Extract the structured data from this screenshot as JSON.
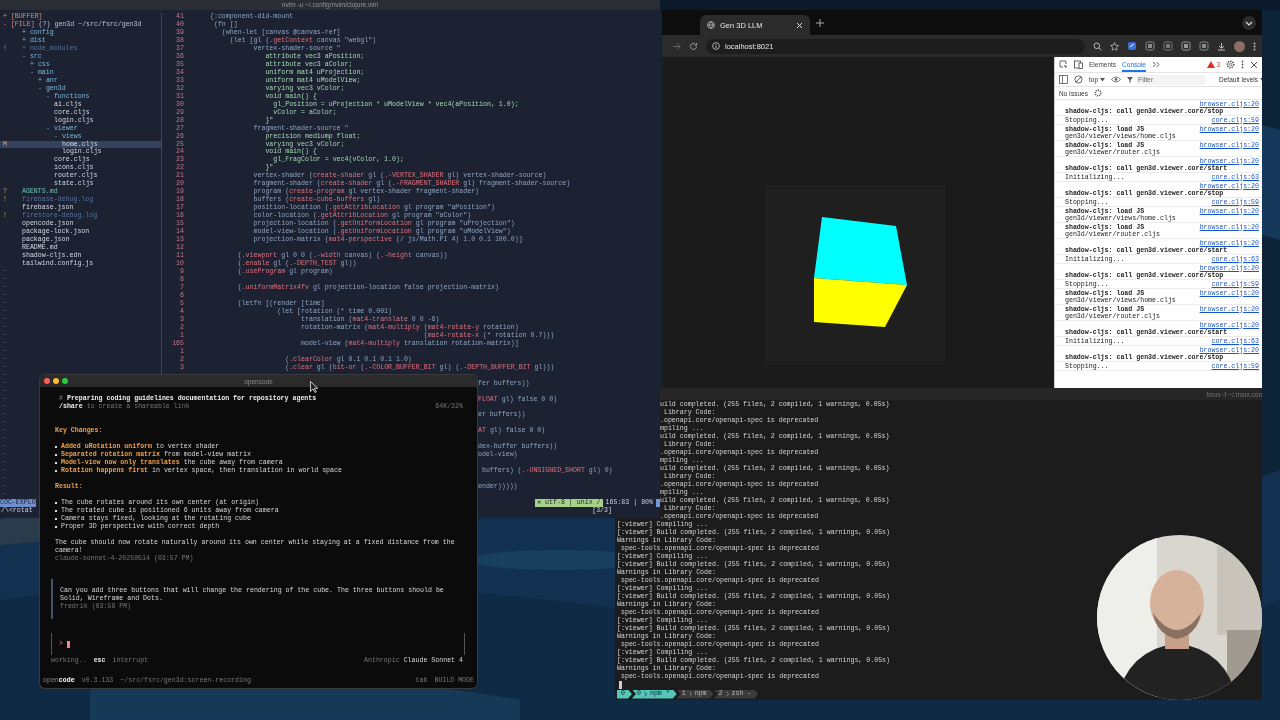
{
  "editor": {
    "title": "nvim -u ~/.config/nvim/clojure.vim",
    "tree": [
      {
        "sign": "+",
        "label": "[BUFFER]",
        "kind": "root",
        "selected": false
      },
      {
        "sign": "-",
        "label": "[FILE]",
        "path": "(?) gen3d ~/src/fsrc/gen3d",
        "kind": "root",
        "selected": false,
        "children": [
          {
            "sign": "+",
            "label": "config",
            "kind": "dir",
            "selected": false
          },
          {
            "sign": "+",
            "label": "dist",
            "kind": "dir",
            "selected": false
          },
          {
            "sign": "+",
            "label": "node_modules",
            "kind": "ignored",
            "mark": "!",
            "selected": false
          },
          {
            "sign": "-",
            "label": "src",
            "kind": "dir",
            "selected": false,
            "children": [
              {
                "sign": "+",
                "label": "css",
                "kind": "dir",
                "selected": false
              },
              {
                "sign": "-",
                "label": "main",
                "kind": "dir",
                "selected": false,
                "children": [
                  {
                    "sign": "+",
                    "label": "anr",
                    "kind": "dir",
                    "selected": false
                  },
                  {
                    "sign": "-",
                    "label": "gen3d",
                    "kind": "dir",
                    "selected": false,
                    "children": [
                      {
                        "sign": "-",
                        "label": "functions",
                        "kind": "dir",
                        "selected": false,
                        "children": [
                          {
                            "label": "ai.cljs",
                            "kind": "file",
                            "selected": false
                          },
                          {
                            "label": "core.cljs",
                            "kind": "file",
                            "selected": false
                          },
                          {
                            "label": "login.cljs",
                            "kind": "file",
                            "selected": false
                          }
                        ]
                      },
                      {
                        "sign": "-",
                        "label": "viewer",
                        "kind": "dir",
                        "selected": false,
                        "children": [
                          {
                            "sign": "-",
                            "label": "views",
                            "kind": "dir",
                            "selected": false,
                            "children": [
                              {
                                "label": "home.cljs",
                                "kind": "file",
                                "mark": "M",
                                "selected": true
                              },
                              {
                                "label": "login.cljs",
                                "kind": "file",
                                "selected": false
                              }
                            ]
                          },
                          {
                            "label": "core.cljs",
                            "kind": "file",
                            "selected": false
                          },
                          {
                            "label": "icons.cljs",
                            "kind": "file",
                            "selected": false
                          },
                          {
                            "label": "router.cljs",
                            "kind": "file",
                            "selected": false
                          },
                          {
                            "label": "state.cljs",
                            "kind": "file",
                            "selected": false
                          }
                        ]
                      }
                    ]
                  }
                ]
              }
            ]
          },
          {
            "label": "AGENTS.md",
            "kind": "untracked",
            "mark": "?",
            "selected": false
          },
          {
            "label": "firebase-debug.log",
            "kind": "ignored",
            "mark": "!",
            "selected": false
          },
          {
            "label": "firebase.json",
            "kind": "file",
            "selected": false
          },
          {
            "label": "firestore-debug.log",
            "kind": "ignored",
            "mark": "!",
            "selected": false
          },
          {
            "label": "opencode.json",
            "kind": "file",
            "selected": false
          },
          {
            "label": "package-lock.json",
            "kind": "file",
            "selected": false
          },
          {
            "label": "package.json",
            "kind": "file",
            "selected": false
          },
          {
            "label": "README.md",
            "kind": "file",
            "selected": false
          },
          {
            "label": "shadow-cljs.edn",
            "kind": "file",
            "selected": false
          },
          {
            "label": "tailwind.config.js",
            "kind": "file",
            "selected": false
          }
        ]
      }
    ],
    "fillers": [
      "~",
      "~",
      "~",
      "~",
      "~",
      "~",
      "~",
      "~",
      "~",
      "~",
      "~",
      "~",
      "~",
      "~",
      "~",
      "~",
      "~",
      "~",
      "~",
      "~",
      "~",
      "~",
      "~",
      "~",
      "~",
      "~",
      "~",
      "~",
      "~"
    ],
    "explorer": {
      "name": "COC-EXPLO",
      "search": "/\\<rotat"
    },
    "code": [
      {
        "number": "41",
        "kind": "code",
        "text": "{:component-did-mount"
      },
      {
        "number": "40",
        "kind": "code",
        "text": " (fn []"
      },
      {
        "number": "39",
        "kind": "code",
        "text": "   (when-let [canvas @canvas-ref]"
      },
      {
        "number": "38",
        "kind": "code",
        "text": "     (let [gl (**.getContext** canvas \"webgl\")"
      },
      {
        "number": "37",
        "kind": "code",
        "text": "           vertex-shader-source \""
      },
      {
        "number": "36",
        "kind": "shader",
        "text": "              attribute vec3 aPosition;"
      },
      {
        "number": "35",
        "kind": "shader",
        "text": "              attribute vec3 aColor;"
      },
      {
        "number": "34",
        "kind": "shader",
        "text": "              uniform mat4 uProjection;"
      },
      {
        "number": "33",
        "kind": "shader",
        "text": "              uniform mat4 uModelView;"
      },
      {
        "number": "32",
        "kind": "shader",
        "text": "              varying vec3 vColor;"
      },
      {
        "number": "31",
        "kind": "shader",
        "text": "              void main() {"
      },
      {
        "number": "30",
        "kind": "shader",
        "text": "                gl_Position = uProjection * uModelView * vec4(aPosition, 1.0);"
      },
      {
        "number": "29",
        "kind": "shader",
        "text": "                vColor = aColor;"
      },
      {
        "number": "28",
        "kind": "shader",
        "text": "              }\""
      },
      {
        "number": "27",
        "kind": "code",
        "text": "           fragment-shader-source \""
      },
      {
        "number": "26",
        "kind": "shader",
        "text": "              precision mediump float;"
      },
      {
        "number": "25",
        "kind": "shader",
        "text": "              varying vec3 vColor;"
      },
      {
        "number": "24",
        "kind": "shader",
        "text": "              void main() {"
      },
      {
        "number": "23",
        "kind": "shader",
        "text": "                gl_FragColor = vec4(vColor, 1.0);"
      },
      {
        "number": "22",
        "kind": "shader",
        "text": "              }\""
      },
      {
        "number": "21",
        "kind": "code",
        "text": "           vertex-shader (**create-shader** gl (**.-VERTEX_SHADER** gl) vertex-shader-source)"
      },
      {
        "number": "20",
        "kind": "code",
        "text": "           fragment-shader (**create-shader** gl (**.-FRAGMENT_SHADER** gl) fragment-shader-source)"
      },
      {
        "number": "19",
        "kind": "code",
        "text": "           program (**create-program** gl vertex-shader fragment-shader)"
      },
      {
        "number": "18",
        "kind": "code",
        "text": "           buffers (**create-cube-buffers** gl)"
      },
      {
        "number": "17",
        "kind": "code",
        "text": "           position-location (**.getAttribLocation** gl program \"aPosition\")"
      },
      {
        "number": "16",
        "kind": "code",
        "text": "           color-location (**.getAttribLocation** gl program \"aColor\")"
      },
      {
        "number": "15",
        "kind": "code",
        "text": "           projection-location (**.getUniformLocation** gl program \"uProjection\")"
      },
      {
        "number": "14",
        "kind": "code",
        "text": "           model-view-location (**.getUniformLocation** gl program \"uModelView\")"
      },
      {
        "number": "13",
        "kind": "code",
        "text": "           projection-matrix (**mat4-perspective** (/ js/Math.PI 4) 1.0 0.1 100.0)]"
      },
      {
        "number": "12",
        "kind": "blank"
      },
      {
        "number": "11",
        "kind": "code",
        "text": "       (**.viewport** gl 0 0 (**.-width** canvas) (**.-height** canvas))"
      },
      {
        "number": "10",
        "kind": "code",
        "text": "       (**.enable** gl (**.-DEPTH_TEST** gl))"
      },
      {
        "number": "9",
        "kind": "code",
        "text": "       (**.useProgram** gl program)"
      },
      {
        "number": "8",
        "kind": "blank"
      },
      {
        "number": "7",
        "kind": "code",
        "text": "       (**.uniformMatrix4fv** gl projection-location false projection-matrix)"
      },
      {
        "number": "6",
        "kind": "blank"
      },
      {
        "number": "5",
        "kind": "code",
        "text": "       (letfn [(render [time]"
      },
      {
        "number": "4",
        "kind": "code",
        "text": "                 (let [rotation (* time 0.001)"
      },
      {
        "number": "3",
        "kind": "code",
        "text": "                       translation (**mat4-translate** 0 0 -6)"
      },
      {
        "number": "2",
        "kind": "code",
        "text": "                       rotation-matrix (**mat4-multiply** (**mat4-rotate-y** rotation)"
      },
      {
        "number": "1",
        "kind": "code",
        "text": "                                                      (**mat4-rotate-x** (* rotation 0.7)))"
      },
      {
        "number": "165",
        "kind": "code",
        "text": "                       model-view (**mat4-multiply** translation rotation-matrix)]"
      },
      {
        "number": "1",
        "kind": "blank"
      },
      {
        "number": "2",
        "kind": "code",
        "text": "                   (**.clearColor** gl 0.1 0.1 0.1 1.0)"
      },
      {
        "number": "3",
        "kind": "code",
        "text": "                   (**.clear** gl (**bit-or** (**.-COLOR_BUFFER_BIT** gl) (**.-DEPTH_BUFFER_BIT** gl)))"
      },
      {
        "kind": "gap"
      },
      {
        "kind": "tail",
        "text": "fer buffers))"
      },
      {
        "kind": "gap"
      },
      {
        "kind": "tail",
        "text": "**FLOAT** gl) false 0 0)"
      },
      {
        "kind": "gap"
      },
      {
        "kind": "tail",
        "text": "er buffers))"
      },
      {
        "kind": "gap"
      },
      {
        "kind": "tail",
        "text": "**AT** gl) false 0 0)"
      },
      {
        "kind": "gap"
      },
      {
        "kind": "tail",
        "text": "dex-buffer buffers))"
      },
      {
        "kind": "tail",
        "text": "odel-view)"
      },
      {
        "kind": "gap"
      },
      {
        "kind": "tail",
        "text": " buffers) (**.-UNSIGNED_SHORT** gl) 0)"
      },
      {
        "kind": "gap"
      },
      {
        "kind": "tail",
        "text": "ender)))))"
      },
      {
        "kind": "gap"
      }
    ],
    "status": {
      "flags": "✕ utf-8 | unix /",
      "position": "165:83 | 80%",
      "tabs": "[3/3]"
    }
  },
  "browser": {
    "tabs": [
      {
        "title": "Gen 3D LLM",
        "selected": true
      }
    ],
    "url": "localhost:8021",
    "devtools": {
      "tabs": [
        {
          "label": "Elements",
          "selected": false
        },
        {
          "label": "Console",
          "selected": true
        }
      ],
      "warnings": "3",
      "context": "top",
      "filter": {
        "placeholder": "Filter"
      },
      "levels": "Default levels",
      "issues": "No Issues",
      "entries": [
        {
          "kind": "call",
          "text": "shadow-cljs: call gen3d.viewer.core/stop",
          "source": "browser.cljs:20"
        },
        {
          "kind": "log",
          "text": "Stopping...",
          "source": "core.cljs:59"
        },
        {
          "kind": "load",
          "text": "shadow-cljs: load JS",
          "detail": "gen3d/viewer/views/home.cljs",
          "source": "browser.cljs:20"
        },
        {
          "kind": "load",
          "text": "shadow-cljs: load JS",
          "detail": "gen3d/viewer/router.cljs",
          "source": "browser.cljs:20"
        },
        {
          "kind": "call",
          "text": "shadow-cljs: call gen3d.viewer.core/start",
          "source": "browser.cljs:20"
        },
        {
          "kind": "log",
          "text": "Initializing...",
          "source": "core.cljs:63"
        },
        {
          "kind": "call",
          "text": "shadow-cljs: call gen3d.viewer.core/stop",
          "source": "browser.cljs:20"
        },
        {
          "kind": "log",
          "text": "Stopping...",
          "source": "core.cljs:59"
        },
        {
          "kind": "load",
          "text": "shadow-cljs: load JS",
          "detail": "gen3d/viewer/views/home.cljs",
          "source": "browser.cljs:20"
        },
        {
          "kind": "load",
          "text": "shadow-cljs: load JS",
          "detail": "gen3d/viewer/router.cljs",
          "source": "browser.cljs:20"
        },
        {
          "kind": "call",
          "text": "shadow-cljs: call gen3d.viewer.core/start",
          "source": "browser.cljs:20"
        },
        {
          "kind": "log",
          "text": "Initializing...",
          "source": "core.cljs:63"
        },
        {
          "kind": "call",
          "text": "shadow-cljs: call gen3d.viewer.core/stop",
          "source": "browser.cljs:20"
        },
        {
          "kind": "log",
          "text": "Stopping...",
          "source": "core.cljs:59"
        },
        {
          "kind": "load",
          "text": "shadow-cljs: load JS",
          "detail": "gen3d/viewer/views/home.cljs",
          "source": "browser.cljs:20"
        },
        {
          "kind": "load",
          "text": "shadow-cljs: load JS",
          "detail": "gen3d/viewer/router.cljs",
          "source": "browser.cljs:20"
        },
        {
          "kind": "call",
          "text": "shadow-cljs: call gen3d.viewer.core/start",
          "source": "browser.cljs:20"
        },
        {
          "kind": "log",
          "text": "Initializing...",
          "source": "core.cljs:63"
        },
        {
          "kind": "call",
          "text": "shadow-cljs: call gen3d.viewer.core/stop",
          "source": "browser.cljs:20"
        },
        {
          "kind": "log",
          "text": "Stopping...",
          "source": "core.cljs:59"
        }
      ]
    }
  },
  "terminal": {
    "title": "tmux -f ~/.tmux.con",
    "lines": [
      {
        "kind": "partial",
        "text": "uild completed. (255 files, 2 compiled, 1 warnings, 0.05s)"
      },
      {
        "kind": "partial",
        "text": " Library Code:"
      },
      {
        "kind": "partial",
        "text": ".openapi.core/openapi-spec is deprecated"
      },
      {
        "kind": "partial",
        "text": "mpiling ..."
      },
      {
        "kind": "partial",
        "text": "uild completed. (255 files, 2 compiled, 1 warnings, 0.05s)"
      },
      {
        "kind": "partial",
        "text": " Library Code:"
      },
      {
        "kind": "partial",
        "text": ".openapi.core/openapi-spec is deprecated"
      },
      {
        "kind": "partial",
        "text": "mpiling ..."
      },
      {
        "kind": "partial",
        "text": "uild completed. (255 files, 2 compiled, 1 warnings, 0.05s)"
      },
      {
        "kind": "partial",
        "text": " Library Code:"
      },
      {
        "kind": "partial",
        "text": ".openapi.core/openapi-spec is deprecated"
      },
      {
        "kind": "partial",
        "text": "mpiling ..."
      },
      {
        "kind": "partial",
        "text": "uild completed. (255 files, 2 compiled, 1 warnings, 0.05s)"
      },
      {
        "kind": "partial",
        "text": " Library Code:"
      },
      {
        "kind": "partial",
        "text": ".openapi.core/openapi-spec is deprecated"
      },
      {
        "kind": "line",
        "text": "[:viewer] Compiling ..."
      },
      {
        "kind": "line",
        "text": "[:viewer] Build completed. (255 files, 2 compiled, 1 warnings, 0.05s)"
      },
      {
        "kind": "line",
        "text": "Warnings in Library Code:"
      },
      {
        "kind": "detail",
        "text": "spec-tools.openapi.core/openapi-spec is deprecated"
      },
      {
        "kind": "line",
        "text": "[:viewer] Compiling ..."
      },
      {
        "kind": "line",
        "text": "[:viewer] Build completed. (255 files, 2 compiled, 1 warnings, 0.05s)"
      },
      {
        "kind": "line",
        "text": "Warnings in Library Code:"
      },
      {
        "kind": "detail",
        "text": "spec-tools.openapi.core/openapi-spec is deprecated"
      },
      {
        "kind": "line",
        "text": "[:viewer] Compiling ..."
      },
      {
        "kind": "line",
        "text": "[:viewer] Build completed. (255 files, 2 compiled, 1 warnings, 0.05s)"
      },
      {
        "kind": "line",
        "text": "Warnings in Library Code:"
      },
      {
        "kind": "detail",
        "text": "spec-tools.openapi.core/openapi-spec is deprecated"
      },
      {
        "kind": "line",
        "text": "[:viewer] Compiling ..."
      },
      {
        "kind": "line",
        "text": "[:viewer] Build completed. (255 files, 2 compiled, 1 warnings, 0.05s)"
      },
      {
        "kind": "line",
        "text": "Warnings in Library Code:"
      },
      {
        "kind": "detail",
        "text": "spec-tools.openapi.core/openapi-spec is deprecated"
      },
      {
        "kind": "line",
        "text": "[:viewer] Compiling ..."
      },
      {
        "kind": "line",
        "text": "[:viewer] Build completed. (255 files, 2 compiled, 1 warnings, 0.05s)"
      },
      {
        "kind": "line",
        "text": "Warnings in Library Code:"
      },
      {
        "kind": "detail",
        "text": "spec-tools.openapi.core/openapi-spec is deprecated"
      }
    ],
    "status": {
      "session": "0",
      "windows": [
        {
          "index": "0",
          "name": "npm *",
          "selected": true
        },
        {
          "index": "1",
          "name": "npm",
          "selected": false
        },
        {
          "index": "2",
          "name": "zsh -",
          "selected": false
        }
      ]
    }
  },
  "opencode": {
    "title": "opencode",
    "header": {
      "title": "# **Preparing coding guidelines documentation for repository agents**",
      "hint": "**/share** to create a shareable link",
      "usage": "64K/32%"
    },
    "reply": [
      {
        "kind": "heading",
        "text": "Key Changes:"
      },
      {
        "kind": "bullets",
        "items": [
          "**Added uRotation uniform** to vertex shader",
          "**Separated rotation matrix** from model-view matrix",
          "**Model-view now only translates** the cube away from camera",
          "**Rotation happens first** in vertex space, then translation in world space"
        ]
      },
      {
        "kind": "heading",
        "text": "Result:"
      },
      {
        "kind": "bullets",
        "items": [
          "The cube rotates around its own center (at origin)",
          "The rotated cube is positioned 6 units away from camera",
          "Camera stays fixed, looking at the rotating cube",
          "Proper 3D perspective with correct depth"
        ]
      },
      {
        "kind": "paragraph",
        "text": "The cube should now rotate naturally around its own center while staying at a fixed distance from the camera!"
      },
      {
        "kind": "meta",
        "text": "claude-sonnet-4-20250514 (03:57 PM)"
      }
    ],
    "user": {
      "text": "Can you add three buttons that will change the rendering of the cube. The three buttons should be Solid, Wireframe and Dots.",
      "meta": "fredrik (03:59 PM)"
    },
    "prompt": ">",
    "status": {
      "activity": "working..",
      "key": "esc",
      "action": "interrupt",
      "provider": "Anthropic",
      "model": "Claude Sonnet 4"
    },
    "footer": {
      "app": "open**code**",
      "version": "v0.3.133",
      "path": "~/src/fsrc/gen3d:screen-recording",
      "key": "tab",
      "mode": "BUILD MODE"
    }
  }
}
